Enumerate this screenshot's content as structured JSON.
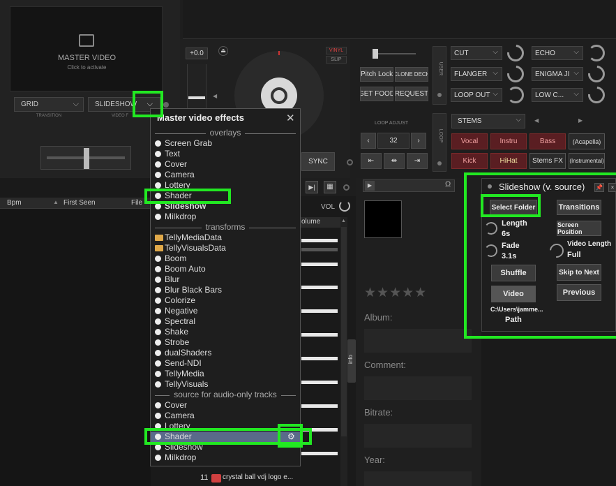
{
  "master_video": {
    "title": "MASTER VIDEO",
    "subtitle": "Click to activate"
  },
  "transition": {
    "value": "GRID",
    "caption": "TRANSITION"
  },
  "video_fx": {
    "value": "SLIDESHOW",
    "caption": "VIDEO F"
  },
  "deck": {
    "pitch": "+0.0",
    "vinyl": "VINYL",
    "slip": "SLIP",
    "sync": "SYNC"
  },
  "user_buttons": [
    "Pitch Lock",
    "CLONE DECK",
    "GET FOOD",
    "REQUEST"
  ],
  "user_label": "USER",
  "effects": {
    "col1": [
      "CUT",
      "FLANGER",
      "LOOP OUT"
    ],
    "col2": [
      "ECHO",
      "ENIGMA JI",
      "LOW C..."
    ]
  },
  "loop": {
    "label": "LOOP ADJUST",
    "side": "LOOP",
    "size": "32"
  },
  "stems": {
    "selector": "STEMS",
    "row1": [
      "Vocal",
      "Instru",
      "Bass",
      "(Acapella)"
    ],
    "row2": [
      "Kick",
      "HiHat",
      "Stems FX",
      "(Instrumental)"
    ]
  },
  "browser": {
    "columns": [
      "Bpm",
      "First Seen",
      "File"
    ],
    "volume_header": "olume",
    "vol_label": "VOL",
    "track_row": {
      "num": "11",
      "title": "crystal ball vdj logo e..."
    },
    "info_tab": "info"
  },
  "info_panel": {
    "labels": [
      "Album:",
      "Comment:",
      "Bitrate:",
      "Year:"
    ]
  },
  "fx_menu": {
    "title": "Master video effects",
    "overlays_header": "overlays",
    "overlays": [
      "Screen Grab",
      "Text",
      "Cover",
      "Camera",
      "Lottery",
      "Shader",
      "Slideshow",
      "Milkdrop"
    ],
    "transforms_header": "transforms",
    "transforms_folders": [
      "TellyMediaData",
      "TellyVisualsData"
    ],
    "transforms": [
      "Boom",
      "Boom Auto",
      "Blur",
      "Blur Black Bars",
      "Colorize",
      "Negative",
      "Spectral",
      "Shake",
      "Strobe",
      "dualShaders",
      "Send-NDI",
      "TellyMedia",
      "TellyVisuals"
    ],
    "audio_header": "source for audio-only tracks",
    "audio_sources": [
      "Cover",
      "Camera",
      "Lottery",
      "Shader",
      "Slideshow",
      "Milkdrop"
    ]
  },
  "slideshow": {
    "title": "Slideshow (v. source)",
    "select_folder": "Select Folder",
    "transitions": "Transitions",
    "screen_position": "Screen Position",
    "length_label": "Length",
    "length_value": "6s",
    "fade_label": "Fade",
    "fade_value": "3.1s",
    "video_length_label": "Video Length",
    "video_length_value": "Full",
    "shuffle": "Shuffle",
    "skip": "Skip to Next",
    "video": "Video",
    "previous": "Previous",
    "path_value": "C:\\Users\\jamme...",
    "path_label": "Path"
  }
}
